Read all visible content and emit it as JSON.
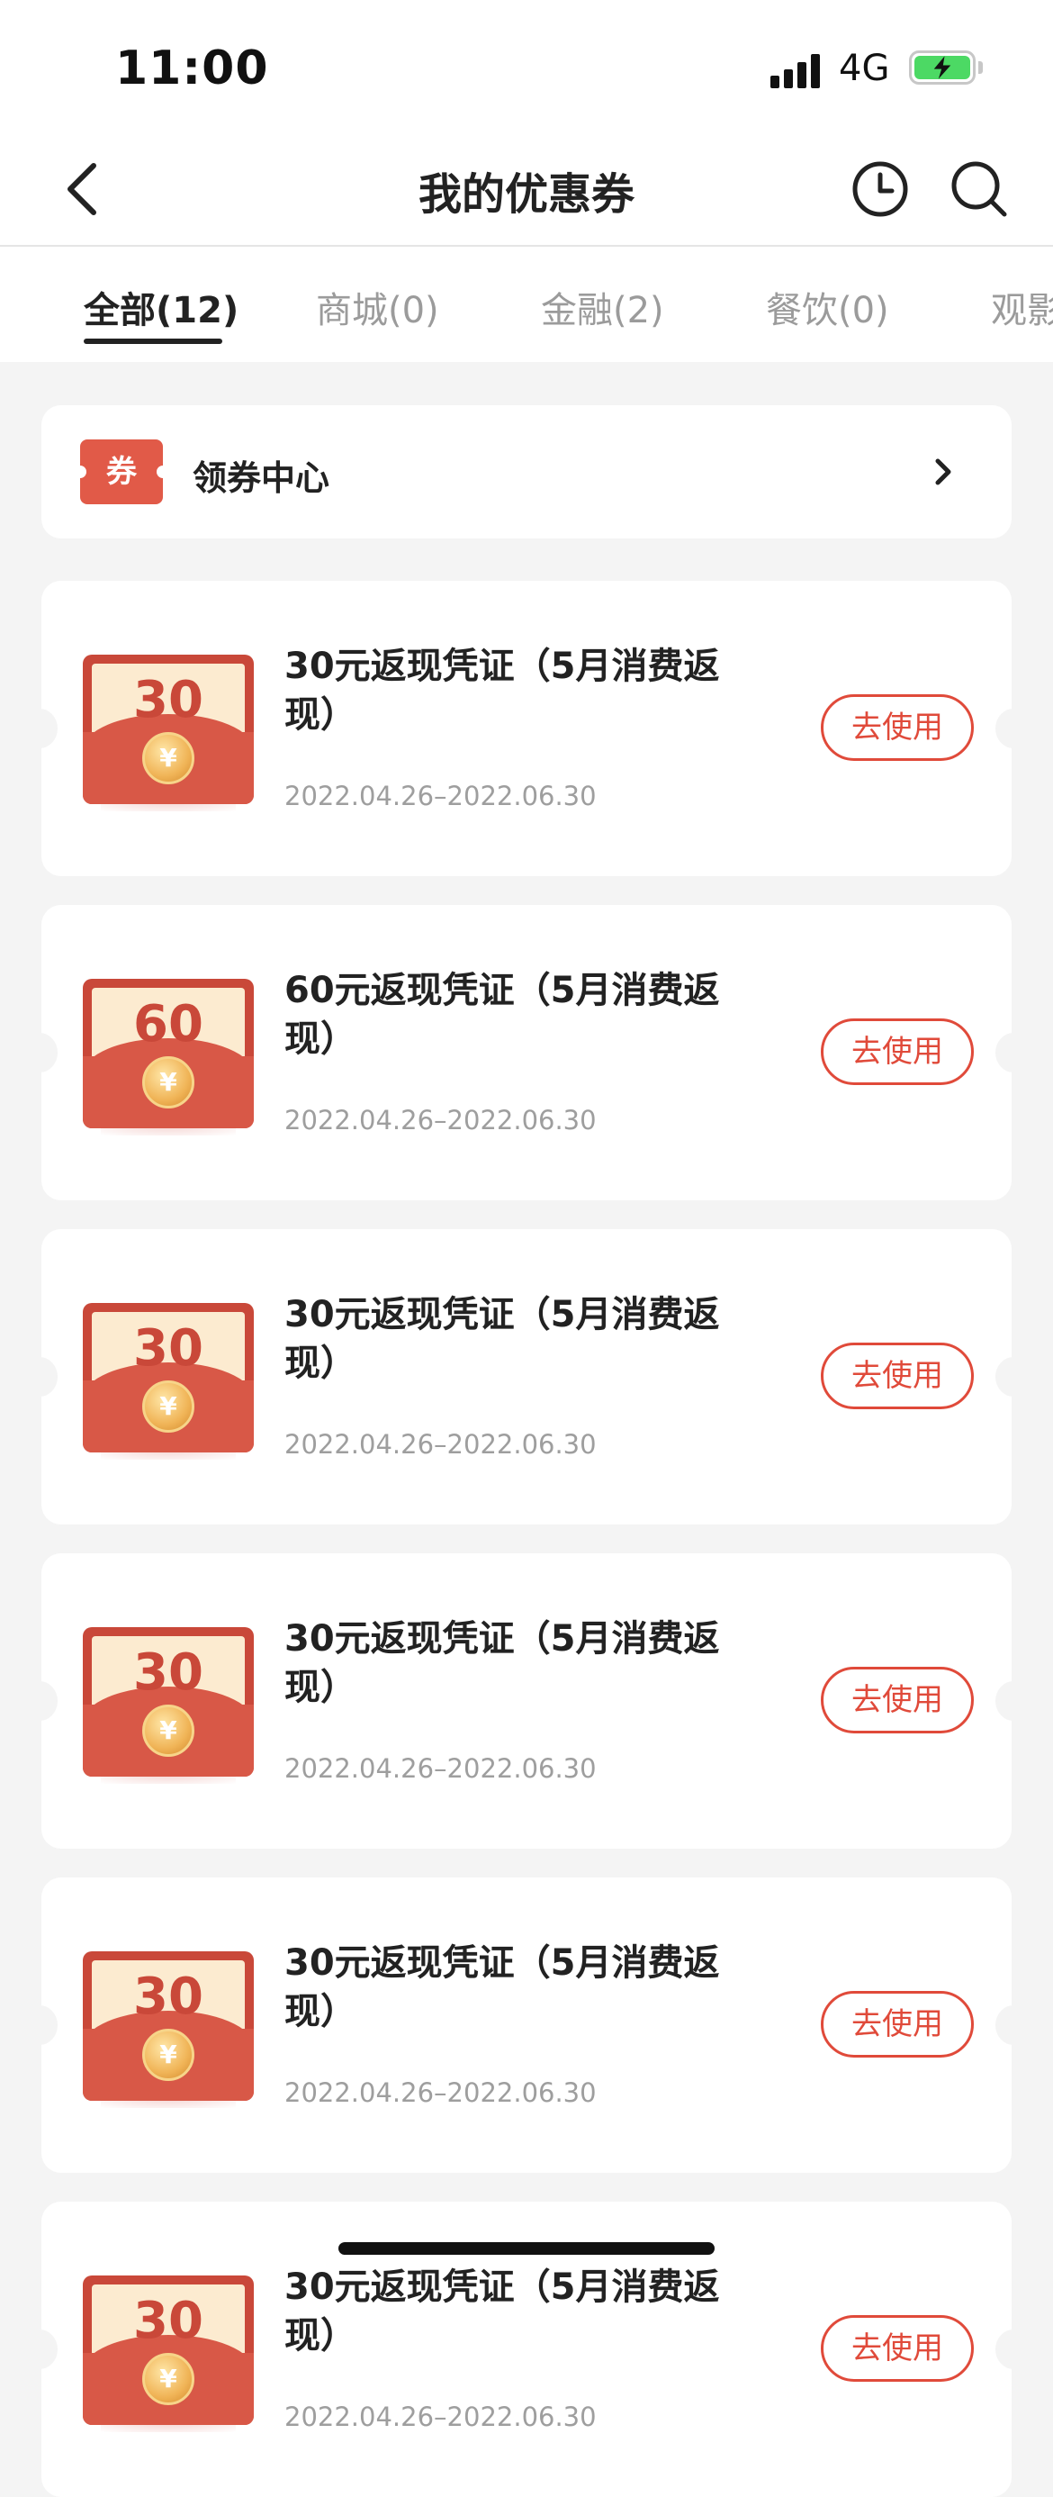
{
  "status_bar": {
    "time": "11:00",
    "network": "4G"
  },
  "nav": {
    "title": "我的优惠券",
    "icons": [
      "back-arrow-icon",
      "clock-icon",
      "search-icon"
    ]
  },
  "tabs": [
    {
      "label": "全部(12)",
      "active": true
    },
    {
      "label": "商城(0)",
      "active": false
    },
    {
      "label": "金融(2)",
      "active": false
    },
    {
      "label": "餐饮(0)",
      "active": false
    },
    {
      "label": "观影",
      "active": false
    }
  ],
  "coupon_center": {
    "badge": "券",
    "label": "领券中心"
  },
  "coupons": [
    {
      "amount": "30",
      "title": "30元返现凭证（5月消费返现）",
      "date": "2022.04.26–2022.06.30",
      "button": "去使用"
    },
    {
      "amount": "60",
      "title": "60元返现凭证（5月消费返现）",
      "date": "2022.04.26–2022.06.30",
      "button": "去使用"
    },
    {
      "amount": "30",
      "title": "30元返现凭证（5月消费返现）",
      "date": "2022.04.26–2022.06.30",
      "button": "去使用"
    },
    {
      "amount": "30",
      "title": "30元返现凭证（5月消费返现）",
      "date": "2022.04.26–2022.06.30",
      "button": "去使用"
    },
    {
      "amount": "30",
      "title": "30元返现凭证（5月消费返现）",
      "date": "2022.04.26–2022.06.30",
      "button": "去使用"
    },
    {
      "amount": "30",
      "title": "30元返现凭证（5月消费返现）",
      "date": "2022.04.26–2022.06.30",
      "button": "去使用"
    }
  ],
  "coin_symbol": "¥",
  "colors": {
    "accent": "#e04a3a",
    "envelope": "#c94839",
    "background": "#f4f4f4"
  }
}
